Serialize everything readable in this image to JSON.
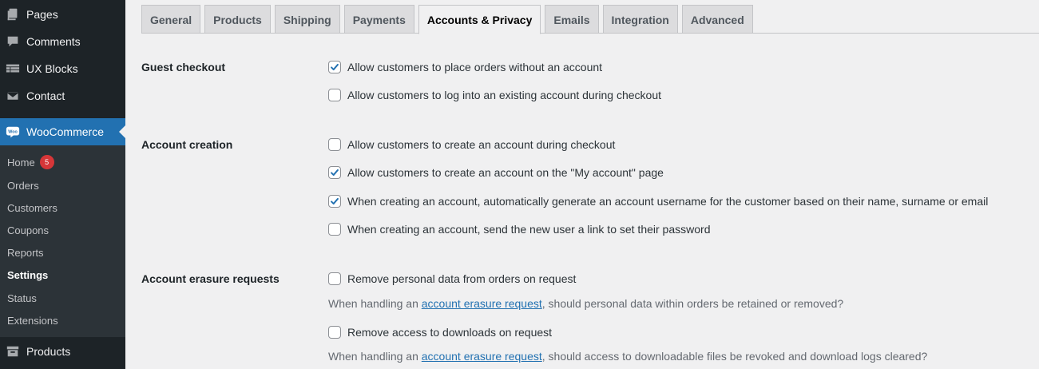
{
  "sidebar": {
    "menu": [
      {
        "label": "Pages",
        "icon": "pages-icon"
      },
      {
        "label": "Comments",
        "icon": "comments-icon"
      },
      {
        "label": "UX Blocks",
        "icon": "ux-blocks-icon"
      },
      {
        "label": "Contact",
        "icon": "envelope-icon"
      },
      {
        "label": "WooCommerce",
        "icon": "woocommerce-icon",
        "active": true
      },
      {
        "label": "Products",
        "icon": "archive-icon"
      }
    ],
    "submenu": [
      {
        "label": "Home",
        "badge": "5"
      },
      {
        "label": "Orders"
      },
      {
        "label": "Customers"
      },
      {
        "label": "Coupons"
      },
      {
        "label": "Reports"
      },
      {
        "label": "Settings",
        "current": true
      },
      {
        "label": "Status"
      },
      {
        "label": "Extensions"
      }
    ]
  },
  "tabs": [
    {
      "label": "General"
    },
    {
      "label": "Products"
    },
    {
      "label": "Shipping"
    },
    {
      "label": "Payments"
    },
    {
      "label": "Accounts & Privacy",
      "active": true
    },
    {
      "label": "Emails"
    },
    {
      "label": "Integration"
    },
    {
      "label": "Advanced"
    }
  ],
  "form": {
    "guest_checkout": {
      "label": "Guest checkout",
      "options": [
        {
          "text": "Allow customers to place orders without an account",
          "checked": true
        },
        {
          "text": "Allow customers to log into an existing account during checkout",
          "checked": false
        }
      ]
    },
    "account_creation": {
      "label": "Account creation",
      "options": [
        {
          "text": "Allow customers to create an account during checkout",
          "checked": false
        },
        {
          "text": "Allow customers to create an account on the \"My account\" page",
          "checked": true
        },
        {
          "text": "When creating an account, automatically generate an account username for the customer based on their name, surname or email",
          "checked": true
        },
        {
          "text": "When creating an account, send the new user a link to set their password",
          "checked": false
        }
      ]
    },
    "erasure": {
      "label": "Account erasure requests",
      "options": [
        {
          "text": "Remove personal data from orders on request",
          "checked": false
        },
        {
          "text": "Remove access to downloads on request",
          "checked": false
        }
      ],
      "desc1": {
        "before": "When handling an ",
        "link": "account erasure request",
        "after": ", should personal data within orders be retained or removed?"
      },
      "desc2": {
        "before": "When handling an ",
        "link": "account erasure request",
        "after": ", should access to downloadable files be revoked and download logs cleared?"
      }
    }
  },
  "colors": {
    "accent": "#2271b1",
    "sidebar": "#1d2327",
    "submenu": "#2c3338",
    "badge": "#d63638"
  }
}
